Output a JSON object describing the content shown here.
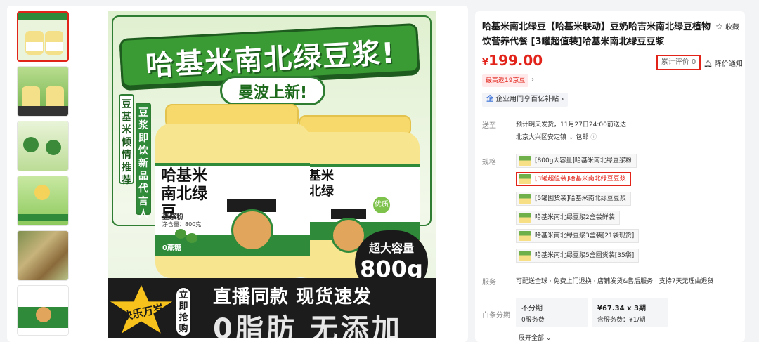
{
  "product": {
    "title": "哈基米南北绿豆【哈基米联动】豆奶哈吉米南北绿豆植物饮营养代餐 [3罐超值装]哈基米南北绿豆豆浆",
    "favorite_label": "收藏",
    "price_currency": "¥",
    "price_value": "199.00",
    "review_label": "累计评价 0",
    "price_alert_label": "降价通知",
    "coupon_label": "最高返19京豆",
    "enterprise_label": "企业用同享百亿补贴",
    "enterprise_icon": "企"
  },
  "shipping": {
    "label": "送至",
    "line1": "预计明天发货，11月27日24:00前送达",
    "address": "北京大兴区安定镇",
    "free_ship": "包邮"
  },
  "specs": {
    "label": "规格",
    "options": [
      "[800g大容量]哈基米南北绿豆浆粉",
      "[3罐超值装]哈基米南北绿豆豆浆",
      "[5罐囤货装]哈基米南北绿豆豆浆",
      "哈基米南北绿豆浆2盒尝鲜装",
      "哈基米南北绿豆浆3盒装[21袋现货]",
      "哈基米南北绿豆浆5盒囤货装[35袋]"
    ],
    "selected_index": 1
  },
  "service": {
    "label": "服务",
    "text": "可配送全球 · 免费上门退换 · 店铺发货&售后服务 · 支持7天无理由退货"
  },
  "installment": {
    "label": "白条分期",
    "options": [
      {
        "title": "不分期",
        "sub": "0服务费"
      },
      {
        "title": "¥67.34 x 3期",
        "sub": "含服务费：¥1/期"
      }
    ],
    "expand_label": "展开全部"
  },
  "hero": {
    "headline": "哈基米南北绿豆浆!",
    "subline": "曼波上新!",
    "vertical_left": "豆基米倾情推荐",
    "vertical_right": "豆浆即饮新品代言人",
    "jar_name": "哈基米南北绿豆",
    "jar_sub": "豆浆粉",
    "jar_weight": "净含量：800克",
    "jar_sugar": "0蔗糖",
    "badge_youzhi": "优质",
    "capacity_label": "超大容量",
    "capacity_value": "800g",
    "live_text": "直播同款 现货速发",
    "zero_text": "0脂肪 无添加",
    "star_text": "快乐万岁",
    "buy_text": "立即抢购"
  },
  "colors": {
    "accent": "#e2231a",
    "brand_green": "#2f8b3a"
  }
}
